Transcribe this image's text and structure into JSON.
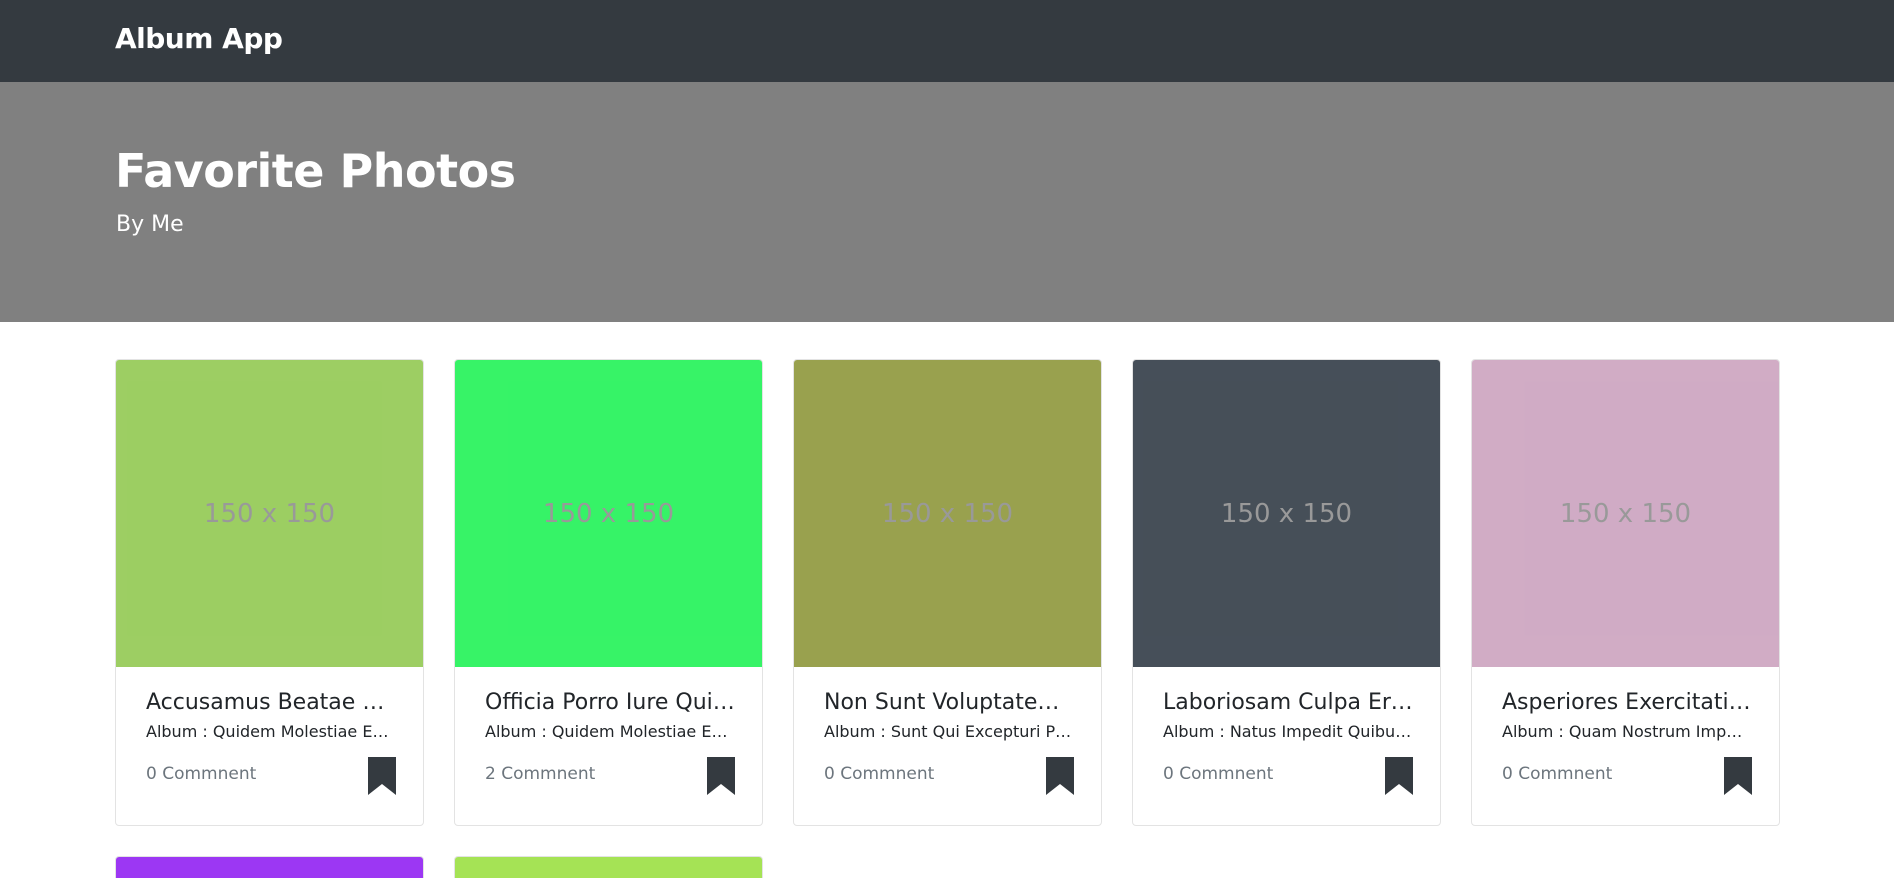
{
  "navbar": {
    "brand": "Album App"
  },
  "hero": {
    "title": "Favorite Photos",
    "subtitle": "By Me"
  },
  "cards": [
    {
      "color": "#92c952",
      "placeholder": "150 x 150",
      "title": "Accusamus Beatae Ad Facilis Cum Similique Qui Sunt",
      "album": "Album : Quidem Molestiae Enim",
      "comments": "0 Commnent"
    },
    {
      "color": "#21f257",
      "placeholder": "150 x 150",
      "title": "Officia Porro Iure Quia Iusto Qui Ipsa Ut Modi",
      "album": "Album : Quidem Molestiae Enim",
      "comments": "2 Commnent"
    },
    {
      "color": "#8e973b",
      "placeholder": "150 x 150",
      "title": "Non Sunt Voluptatem Placeat Consequuntur Rem Incidunt",
      "album": "Album : Sunt Qui Excepturi Placeat Culpa",
      "comments": "0 Commnent"
    },
    {
      "color": "#323c47",
      "placeholder": "150 x 150",
      "title": "Laboriosam Culpa Error Saepe",
      "album": "Album : Natus Impedit Quibusdam Illo Est",
      "comments": "0 Commnent"
    },
    {
      "color": "#cca3bf",
      "placeholder": "150 x 150",
      "title": "Asperiores Exercitationem Voluptates Qui Amet Quae",
      "album": "Album : Quam Nostrum Impedit Mollitia Quod Et Dolor",
      "comments": "0 Commnent"
    }
  ],
  "partial_cards": [
    {
      "color": "#9121f2"
    },
    {
      "color": "#9be042"
    }
  ],
  "icons": {
    "bookmark": "bookmark-icon"
  },
  "colors": {
    "navbar": "#343a40",
    "hero": "#808080",
    "bookmark": "#343a40"
  }
}
